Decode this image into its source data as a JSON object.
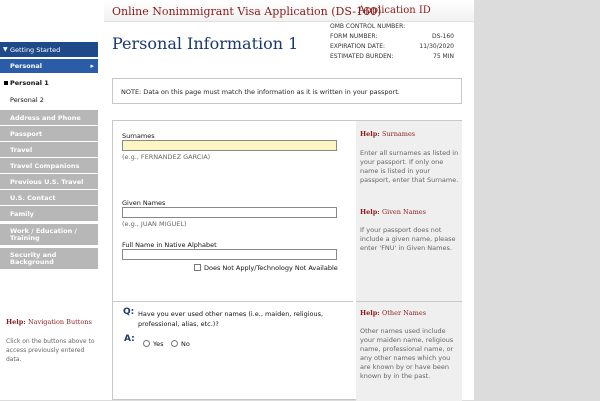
{
  "header": {
    "app_title": "Online Nonimmigrant Visa Application (DS-160)",
    "app_id_label": "Application ID",
    "omb": [
      {
        "label": "OMB CONTROL NUMBER:",
        "value": ""
      },
      {
        "label": "FORM NUMBER:",
        "value": "DS-160"
      },
      {
        "label": "EXPIRATION DATE:",
        "value": "11/30/2020"
      },
      {
        "label": "ESTIMATED BURDEN:",
        "value": "75 MIN"
      }
    ]
  },
  "page_title": "Personal Information 1",
  "note": "NOTE: Data on this page must match the information as it is written in your passport.",
  "sidebar": {
    "getting_started": "Getting Started",
    "personal": "Personal",
    "sub_items": [
      "Personal 1",
      "Personal 2"
    ],
    "sections": [
      "Address and Phone",
      "Passport",
      "Travel",
      "Travel Companions",
      "Previous U.S. Travel",
      "U.S. Contact",
      "Family"
    ],
    "work_education": [
      "Work / Education /",
      "Training"
    ],
    "security": [
      "Security and",
      "Background"
    ],
    "help_heading": "Help:",
    "help_topic": "Navigation Buttons",
    "help_text": "Click on the buttons above to access previously entered data."
  },
  "form": {
    "surnames_label": "Surnames",
    "surnames_value": "",
    "surnames_hint": "(e.g., FERNANDEZ GARCIA)",
    "given_label": "Given Names",
    "given_value": "",
    "given_hint": "(e.g., JUAN MIGUEL)",
    "native_label": "Full Name in Native Alphabet",
    "native_value": "",
    "native_na_label": "Does Not Apply/Technology Not Available",
    "q_marker": "Q:",
    "a_marker": "A:",
    "other_names_question": "Have you ever used other names (i.e., maiden, religious, professional, alias, etc.)?",
    "yes_label": "Yes",
    "no_label": "No"
  },
  "help": {
    "heading": "Help:",
    "surnames_topic": "Surnames",
    "surnames_text": "Enter all surnames as listed in your passport. If only one name is listed in your passport, enter that Surname.",
    "given_topic": "Given Names",
    "given_text": "If your passport does not include a given name, please enter 'FNU' in Given Names.",
    "other_topic": "Other Names",
    "other_text": "Other names used include your maiden name, religious name, professional name, or any other names which you are known by or have been known by in the past."
  },
  "colors": {
    "accent_blue": "#1f4a8a",
    "title_red": "#8b1a1a",
    "nav_gray": "#b7b7b7",
    "required_yellow": "#fdf6c4"
  }
}
